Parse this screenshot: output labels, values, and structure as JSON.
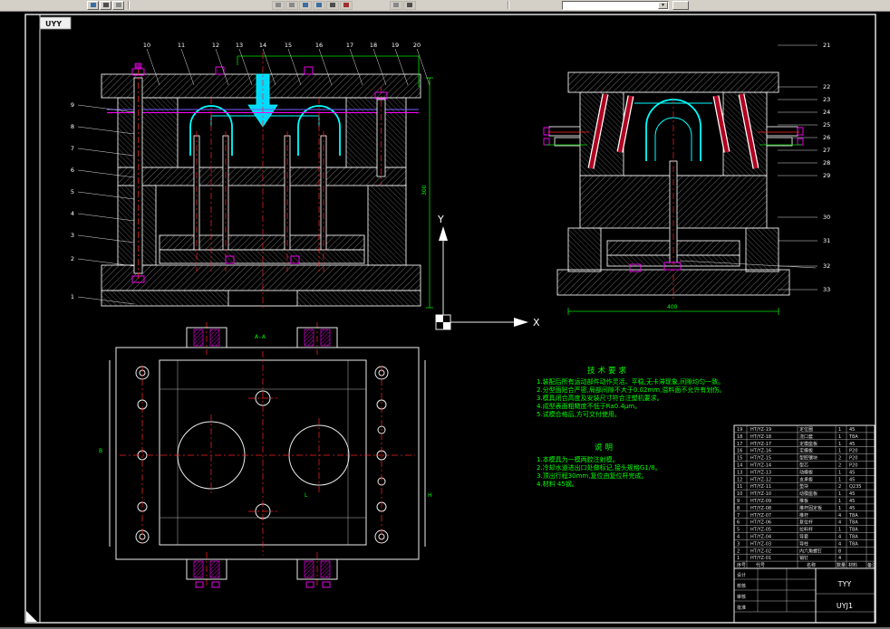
{
  "toolbar": {
    "combo_value": "",
    "buttons": [
      "open",
      "save",
      "print",
      "zoom",
      "pan",
      "undo",
      "redo",
      "layers"
    ]
  },
  "canvas": {
    "label": "UYY"
  },
  "ucs": {
    "x_label": "X",
    "y_label": "Y"
  },
  "plan": {
    "section_label": "A-A",
    "datum_b": "B",
    "datum_l": "L",
    "datum_h": "H"
  },
  "dims": {
    "front_height": "300",
    "side_width": "400"
  },
  "balloons": {
    "front_top": [
      "10",
      "11",
      "12",
      "13",
      "14",
      "15",
      "16",
      "17",
      "18",
      "19",
      "20"
    ],
    "front_left": [
      "9",
      "8",
      "7",
      "6",
      "5",
      "4",
      "3",
      "2",
      "1"
    ],
    "side_right": [
      "21",
      "22",
      "23",
      "24",
      "25",
      "26",
      "27",
      "28",
      "29",
      "30",
      "31",
      "32",
      "33"
    ]
  },
  "notes": {
    "tech_title": "技术要求",
    "tech_lines": [
      "1.装配后所有运动部件动作灵活、平稳,无卡滞现象,间隙均匀一致。",
      "2.分型面贴合严密,局部间隙不大于0.02mm,溢料面不允许有划伤。",
      "3.模具闭合高度及安装尺寸符合注塑机要求。",
      "4.成型表面粗糙度不低于Ra0.4μm。",
      "5.试模合格后,方可交付使用。"
    ],
    "desc_title": "说明",
    "desc_lines": [
      "1.本模具为一模两腔注射模。",
      "2.冷却水道进出口处做标记,接头规格G1/8。",
      "3.顶出行程30mm,复位由复位杆完成。",
      "4.材料 45钢。"
    ]
  },
  "title_block": {
    "headers": [
      "序号",
      "代号",
      "名称",
      "数量",
      "材料",
      "备注"
    ],
    "rows": [
      {
        "no": "19",
        "code": "HT/YZ-19",
        "name": "定位圈",
        "qty": "1",
        "mat": "45"
      },
      {
        "no": "18",
        "code": "HT/YZ-18",
        "name": "浇口套",
        "qty": "1",
        "mat": "T8A"
      },
      {
        "no": "17",
        "code": "HT/YZ-17",
        "name": "定模座板",
        "qty": "1",
        "mat": "45"
      },
      {
        "no": "16",
        "code": "HT/YZ-16",
        "name": "定模板",
        "qty": "1",
        "mat": "P20"
      },
      {
        "no": "15",
        "code": "HT/YZ-15",
        "name": "型腔镶块",
        "qty": "2",
        "mat": "P20"
      },
      {
        "no": "14",
        "code": "HT/YZ-14",
        "name": "型芯",
        "qty": "2",
        "mat": "P20"
      },
      {
        "no": "13",
        "code": "HT/YZ-13",
        "name": "动模板",
        "qty": "1",
        "mat": "45"
      },
      {
        "no": "12",
        "code": "HT/YZ-12",
        "name": "支承板",
        "qty": "1",
        "mat": "45"
      },
      {
        "no": "11",
        "code": "HT/YZ-11",
        "name": "垫块",
        "qty": "2",
        "mat": "Q235"
      },
      {
        "no": "10",
        "code": "HT/YZ-10",
        "name": "动模座板",
        "qty": "1",
        "mat": "45"
      },
      {
        "no": "9",
        "code": "HT/YZ-09",
        "name": "推板",
        "qty": "1",
        "mat": "45"
      },
      {
        "no": "8",
        "code": "HT/YZ-08",
        "name": "推杆固定板",
        "qty": "1",
        "mat": "45"
      },
      {
        "no": "7",
        "code": "HT/YZ-07",
        "name": "推杆",
        "qty": "4",
        "mat": "T8A"
      },
      {
        "no": "6",
        "code": "HT/YZ-06",
        "name": "复位杆",
        "qty": "4",
        "mat": "T8A"
      },
      {
        "no": "5",
        "code": "HT/YZ-05",
        "name": "拉料杆",
        "qty": "1",
        "mat": "T8A"
      },
      {
        "no": "4",
        "code": "HT/YZ-04",
        "name": "导套",
        "qty": "4",
        "mat": "T8A"
      },
      {
        "no": "3",
        "code": "HT/YZ-03",
        "name": "导柱",
        "qty": "4",
        "mat": "T8A"
      },
      {
        "no": "2",
        "code": "HT/YZ-02",
        "name": "内六角螺钉",
        "qty": "8",
        "mat": ""
      },
      {
        "no": "1",
        "code": "HT/YZ-01",
        "name": "销钉",
        "qty": "4",
        "mat": ""
      }
    ],
    "sign_labels": [
      "设计",
      "校核",
      "审核",
      "批准"
    ],
    "code": "TYY",
    "number": "UYJ1"
  }
}
